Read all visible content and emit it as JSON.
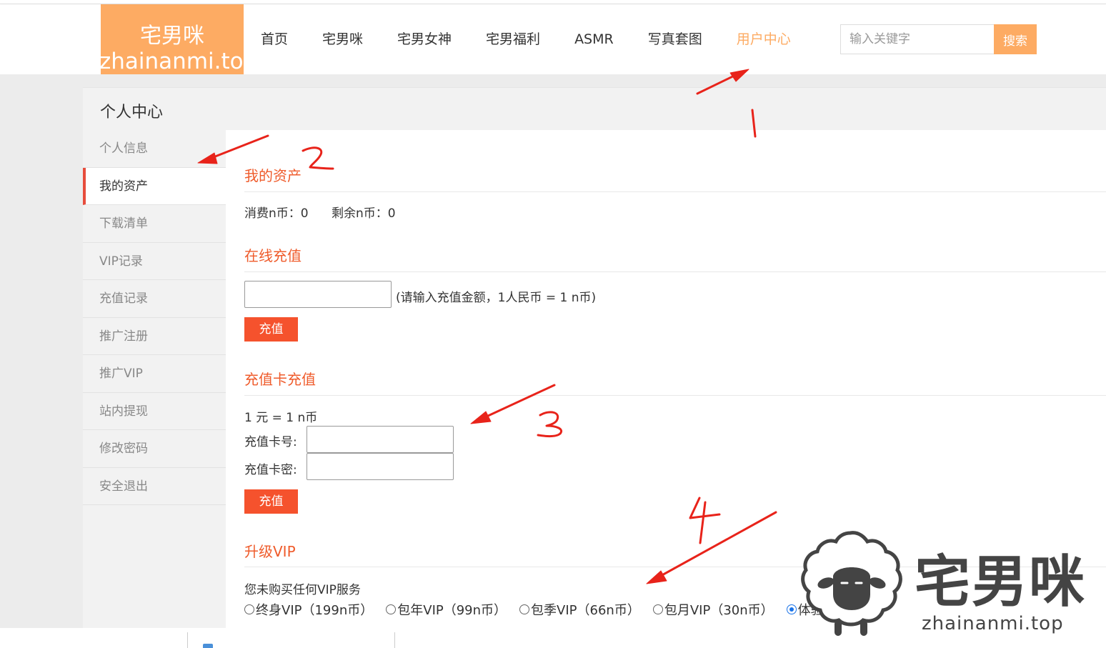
{
  "logo": {
    "line1": "宅男咪",
    "line2": "zhainanmi.top"
  },
  "nav": {
    "items": [
      {
        "label": "首页"
      },
      {
        "label": "宅男咪"
      },
      {
        "label": "宅男女神"
      },
      {
        "label": "宅男福利"
      },
      {
        "label": "ASMR"
      },
      {
        "label": "写真套图"
      },
      {
        "label": "用户中心"
      }
    ],
    "active": "用户中心"
  },
  "search": {
    "placeholder": "输入关键字",
    "button": "搜索"
  },
  "panel": {
    "title": "个人中心"
  },
  "sidebar": {
    "items": [
      {
        "label": "个人信息"
      },
      {
        "label": "我的资产"
      },
      {
        "label": "下载清单"
      },
      {
        "label": "VIP记录"
      },
      {
        "label": "充值记录"
      },
      {
        "label": "推广注册"
      },
      {
        "label": "推广VIP"
      },
      {
        "label": "站内提现"
      },
      {
        "label": "修改密码"
      },
      {
        "label": "安全退出"
      }
    ],
    "active": "我的资产"
  },
  "assets": {
    "title": "我的资产",
    "consumed": "消费n币：0",
    "remaining": "剩余n币：0"
  },
  "online": {
    "title": "在线充值",
    "hint": "(请输入充值金额，1人民币 = 1 n币)",
    "button": "充值"
  },
  "card": {
    "title": "充值卡充值",
    "rate": "1 元 = 1 n币",
    "number_label": "充值卡号:",
    "password_label": "充值卡密:",
    "button": "充值"
  },
  "vip": {
    "title": "升级VIP",
    "status": "您未购买任何VIP服务",
    "options": [
      {
        "label": "终身VIP（199n币）",
        "checked": false
      },
      {
        "label": "包年VIP（99n币）",
        "checked": false
      },
      {
        "label": "包季VIP（66n币）",
        "checked": false
      },
      {
        "label": "包月VIP（30n币）",
        "checked": false
      },
      {
        "label": "体验vip",
        "checked": true
      }
    ]
  },
  "annotations": [
    "1",
    "2",
    "3",
    "4"
  ],
  "watermark": {
    "brand": "宅男咪",
    "url": "zhainanmi.top"
  },
  "colors": {
    "accent": "#fdab63",
    "red": "#f5522d",
    "title_red": "#ef5b2b"
  }
}
